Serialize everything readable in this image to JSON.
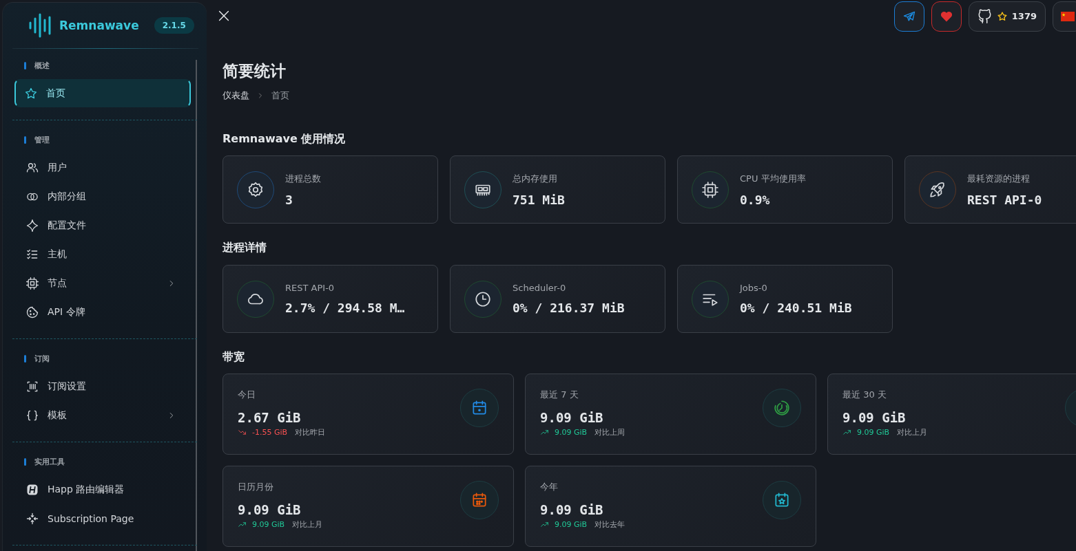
{
  "brand": {
    "name": "Remnawave",
    "version": "2.1.5"
  },
  "sidebar": {
    "sections": [
      {
        "title": "概述",
        "items": [
          {
            "label": "首页",
            "selected": true,
            "submenu": false
          }
        ]
      },
      {
        "title": "管理",
        "items": [
          {
            "label": "用户",
            "selected": false,
            "submenu": false
          },
          {
            "label": "内部分组",
            "selected": false,
            "submenu": false
          },
          {
            "label": "配置文件",
            "selected": false,
            "submenu": false
          },
          {
            "label": "主机",
            "selected": false,
            "submenu": false
          },
          {
            "label": "节点",
            "selected": false,
            "submenu": true
          },
          {
            "label": "API 令牌",
            "selected": false,
            "submenu": false
          }
        ]
      },
      {
        "title": "订阅",
        "items": [
          {
            "label": "订阅设置",
            "selected": false,
            "submenu": false
          },
          {
            "label": "模板",
            "selected": false,
            "submenu": true
          }
        ]
      },
      {
        "title": "实用工具",
        "items": [
          {
            "label": "Happ 路由编辑器",
            "selected": false,
            "submenu": false
          },
          {
            "label": "Subscription Page",
            "selected": false,
            "submenu": false
          }
        ]
      }
    ]
  },
  "header": {
    "github_stars": "1379"
  },
  "page": {
    "title": "简要统计",
    "breadcrumbs": [
      "仪表盘",
      "首页"
    ]
  },
  "usage": {
    "title": "Remnawave 使用情况",
    "cards": [
      {
        "label": "进程总数",
        "value": "3",
        "color": "#1f4a78"
      },
      {
        "label": "总内存使用",
        "value": "751 MiB",
        "color": "#1f4f55"
      },
      {
        "label": "CPU 平均使用率",
        "value": "0.9%",
        "color": "#1f4a30"
      },
      {
        "label": "最耗资源的进程",
        "value": "REST API-0",
        "color": "#5a3522"
      }
    ]
  },
  "processes": {
    "title": "进程详情",
    "cards": [
      {
        "label": "REST API-0",
        "value": "2.7% / 294.58 M…",
        "color": "#1f4a30"
      },
      {
        "label": "Scheduler-0",
        "value": "0% / 216.37 MiB",
        "color": "#1f4a30"
      },
      {
        "label": "Jobs-0",
        "value": "0% / 240.51 MiB",
        "color": "#1f4a30"
      }
    ]
  },
  "bandwidth": {
    "title": "带宽",
    "cards": [
      {
        "label": "今日",
        "value": "2.67 GiB",
        "delta": "-1.55 GiB",
        "compare": "对比昨日",
        "kind": "down",
        "color": "#228be6"
      },
      {
        "label": "最近 7 天",
        "value": "9.09 GiB",
        "delta": "9.09 GiB",
        "compare": "对比上周",
        "kind": "up",
        "color": "#2f9e44"
      },
      {
        "label": "最近 30 天",
        "value": "9.09 GiB",
        "delta": "9.09 GiB",
        "compare": "对比上月",
        "kind": "up"
      },
      {
        "label": "日历月份",
        "value": "9.09 GiB",
        "delta": "9.09 GiB",
        "compare": "对比上月",
        "kind": "up",
        "color": "#e8590c"
      },
      {
        "label": "今年",
        "value": "9.09 GiB",
        "delta": "9.09 GiB",
        "compare": "对比去年",
        "kind": "up",
        "color": "#22b8cf"
      }
    ]
  }
}
